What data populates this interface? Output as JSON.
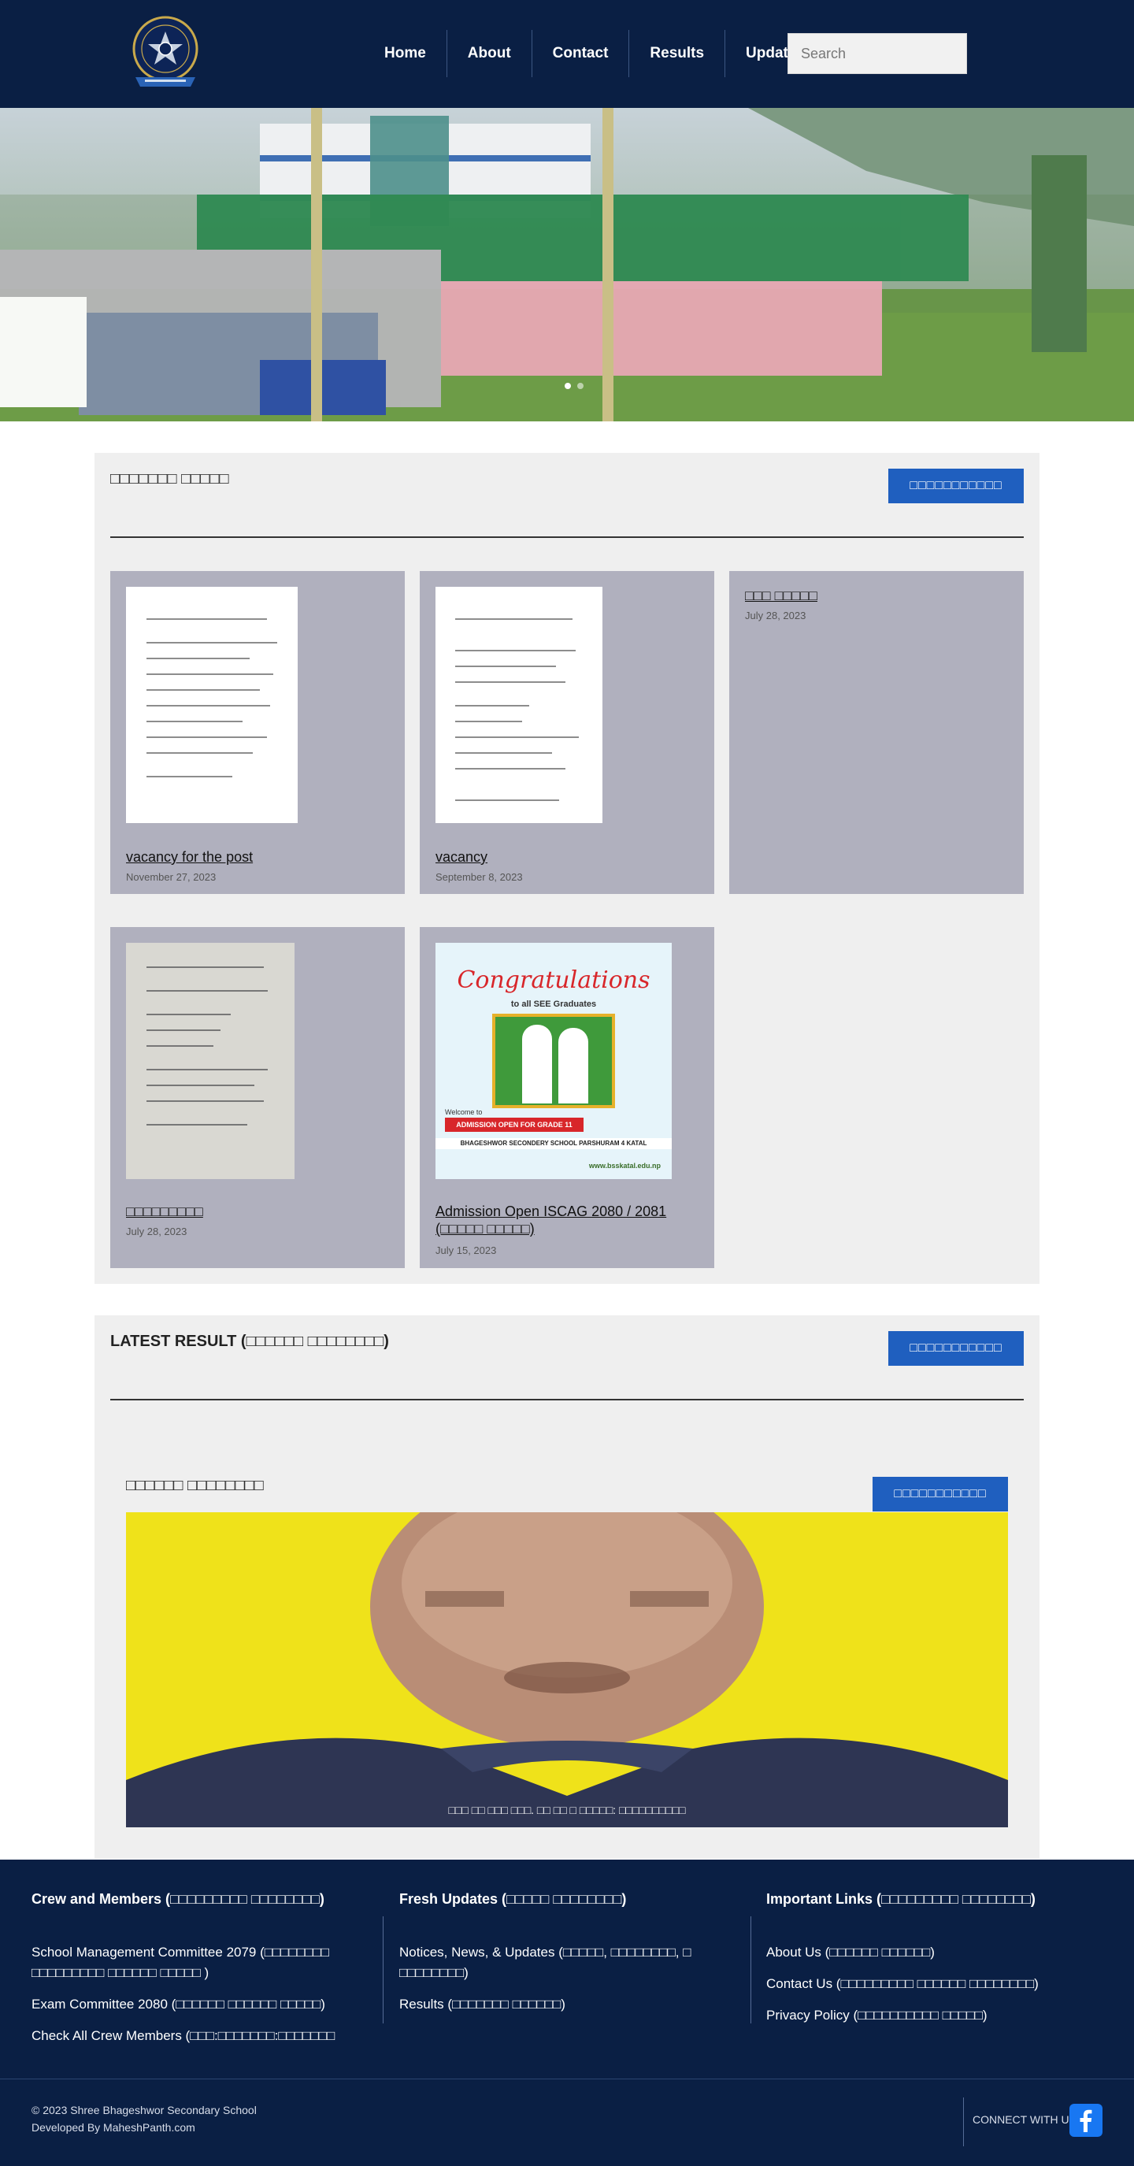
{
  "header": {
    "logo_alt": "Shree Bhageshwor Secondary School logo",
    "nav": [
      "Home",
      "About",
      "Contact",
      "Results",
      "Updates"
    ],
    "search_placeholder": "Search"
  },
  "hero": {
    "slides": 2,
    "active_slide": 1
  },
  "notices": {
    "title": "□□□□□□□ □□□□□",
    "view_all": "□□□□□□□□□□□",
    "cards": [
      {
        "title": "vacancy for the post",
        "date": "November 27, 2023"
      },
      {
        "title": "vacancy",
        "date": "September 8, 2023"
      },
      {
        "title": "□□□ □□□□□",
        "date": "July 28, 2023"
      },
      {
        "title": "□□□□□□□□□",
        "date": "July 28, 2023"
      },
      {
        "title": "Admission Open ISCAG 2080 / 2081 (□□□□□ □□□□□)",
        "date": "July 15, 2023"
      }
    ],
    "poster": {
      "headline": "Congratulations",
      "sub": "to all SEE Graduates",
      "welcome": "Welcome to",
      "admission": "ADMISSION OPEN FOR GRADE 11",
      "school": "BHAGESHWOR SECONDERY SCHOOL PARSHURAM 4 KATAL",
      "url": "www.bsskatal.edu.np"
    }
  },
  "results": {
    "title": "LATEST RESULT (□□□□□□ □□□□□□□□)",
    "view_all": "□□□□□□□□□□□",
    "panel_title": "□□□□□□ □□□□□□□□",
    "panel_view_all": "□□□□□□□□□□□",
    "caption": "□□□ □□ □□□ □□□. □□ □□ □ □□□□□: □□□□□□□□□□"
  },
  "footer": {
    "col1": {
      "heading": "Crew and Members (□□□□□□□□□ □□□□□□□□)",
      "links": [
        "School Management Committee 2079 (□□□□□□□□ □□□□□□□□□ □□□□□□ □□□□□ )",
        "Exam Committee 2080 (□□□□□□ □□□□□□ □□□□□)",
        "Check All Crew Members (□□□:□□□□□□□:□□□□□□□"
      ]
    },
    "col2": {
      "heading": "Fresh Updates (□□□□□ □□□□□□□□)",
      "links": [
        "Notices, News, & Updates (□□□□□, □□□□□□□□, □ □□□□□□□□)",
        "Results (□□□□□□□ □□□□□□)"
      ]
    },
    "col3": {
      "heading": "Important Links (□□□□□□□□□ □□□□□□□□)",
      "links": [
        "About Us (□□□□□□ □□□□□□)",
        "Contact Us (□□□□□□□□□ □□□□□□ □□□□□□□□)",
        "Privacy Policy (□□□□□□□□□□ □□□□□)"
      ]
    },
    "copyright": "© 2023 Shree Bhageshwor Secondary School",
    "developer": "Developed By MaheshPanth.com",
    "connect": "CONNECT WITH US:",
    "colors": {
      "bg": "#0a1f44",
      "facebook": "#1877f2"
    }
  },
  "colors": {
    "primary": "#0a1f44",
    "button": "#1f5fbf",
    "card": "#b0b0be",
    "panel": "#efefef"
  }
}
